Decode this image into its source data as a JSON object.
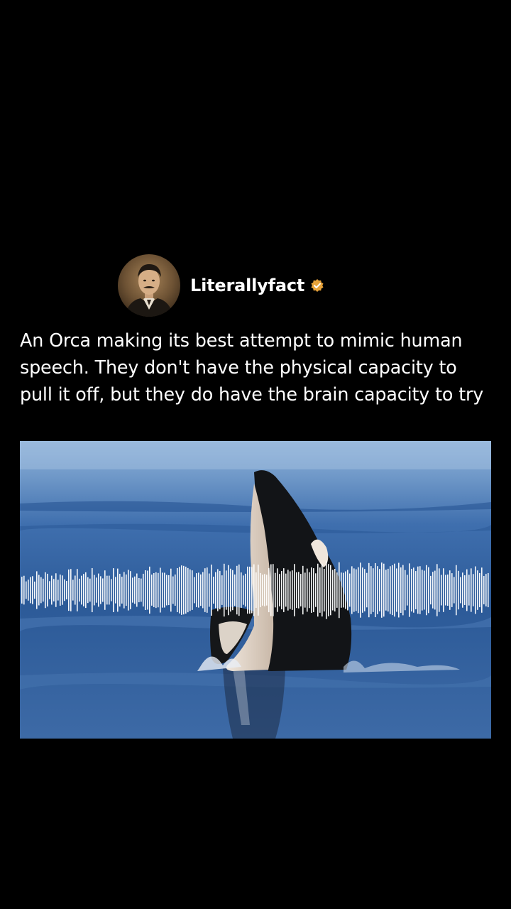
{
  "post": {
    "author": "Literallyfact",
    "avatar_icon": "portrait-avatar-icon",
    "verified_icon": "verified-badge-icon",
    "caption": "An Orca making its best attempt to mimic human speech. They don't have the physical capacity to pull it off, but they do have the brain capacity to try"
  },
  "media": {
    "subject_icon": "orca-icon",
    "waveform_icon": "audio-waveform-icon"
  },
  "colors": {
    "background": "#000000",
    "text": "#ffffff",
    "verified_badge": "#e8a33a",
    "sea": "#2f5e9e"
  }
}
